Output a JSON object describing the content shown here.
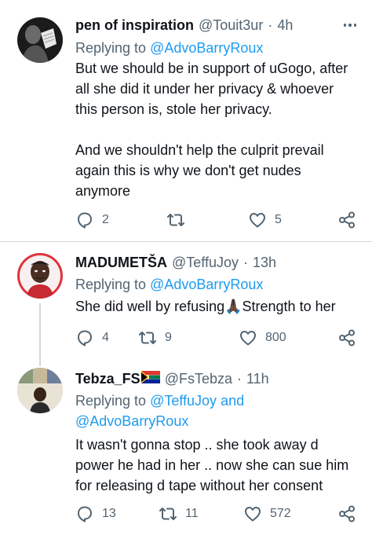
{
  "tweets": [
    {
      "name": "pen of inspiration",
      "handle": "@Touit3ur",
      "time": "4h",
      "replying_label": "Replying to",
      "replying_to": [
        "@AdvoBarryRoux"
      ],
      "text_paragraphs": [
        "But we should be in support of uGogo, after all she did it under her privacy & whoever this person is, stole her privacy.",
        "And we shouldn't help the culprit prevail again this is why we don't get nudes anymore"
      ],
      "replies": "2",
      "retweets": "",
      "likes": "5"
    },
    {
      "name": "MADUMETŠA",
      "handle": "@TeffuJoy",
      "time": "13h",
      "replying_label": "Replying to",
      "replying_to": [
        "@AdvoBarryRoux"
      ],
      "text_paragraphs": [
        "She did well by refusing🙏🏿Strength to her"
      ],
      "replies": "4",
      "retweets": "9",
      "likes": "800"
    },
    {
      "name": "Tebza_FS",
      "name_flag": "south-africa-flag",
      "handle": "@FsTebza",
      "time": "11h",
      "replying_label": "Replying to",
      "replying_to": [
        "@TeffuJoy",
        "@AdvoBarryRoux"
      ],
      "replying_joiner": "and",
      "text_paragraphs": [
        "It wasn't gonna stop .. she took away d power he had in her .. now she can sue him for releasing d tape without her consent"
      ],
      "replies": "13",
      "retweets": "11",
      "likes": "572"
    }
  ],
  "icons": {
    "reply": "reply-bubble-icon",
    "retweet": "retweet-icon",
    "like": "heart-icon",
    "share": "share-icon",
    "more": "more-dots-icon"
  },
  "colors": {
    "text": "#0f1419",
    "secondary": "#536471",
    "link": "#1d9bf0",
    "border": "#cfd9de"
  }
}
